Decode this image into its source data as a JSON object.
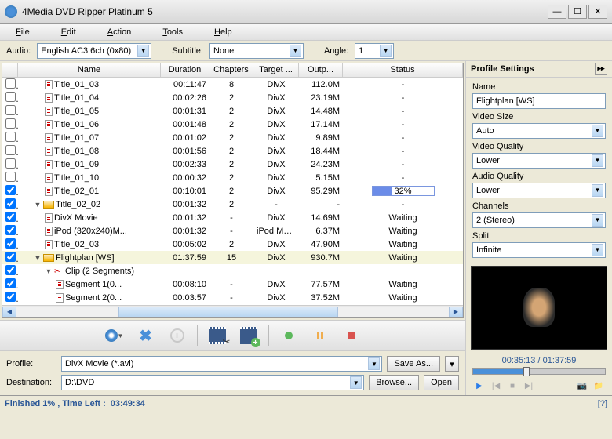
{
  "window": {
    "title": "4Media DVD Ripper Platinum 5"
  },
  "menu": [
    "File",
    "Edit",
    "Action",
    "Tools",
    "Help"
  ],
  "toolbar": {
    "audio_label": "Audio:",
    "audio_value": "English AC3 6ch (0x80)",
    "subtitle_label": "Subtitle:",
    "subtitle_value": "None",
    "angle_label": "Angle:",
    "angle_value": "1"
  },
  "columns": [
    "",
    "Name",
    "Duration",
    "Chapters",
    "Target ...",
    "Outp...",
    "Status"
  ],
  "rows": [
    {
      "chk": false,
      "indent": 2,
      "icon": "file",
      "name": "Title_01_03",
      "dur": "00:11:47",
      "chap": "8",
      "tar": "DivX",
      "out": "112.0M",
      "stat": "-"
    },
    {
      "chk": false,
      "indent": 2,
      "icon": "file",
      "name": "Title_01_04",
      "dur": "00:02:26",
      "chap": "2",
      "tar": "DivX",
      "out": "23.19M",
      "stat": "-"
    },
    {
      "chk": false,
      "indent": 2,
      "icon": "file",
      "name": "Title_01_05",
      "dur": "00:01:31",
      "chap": "2",
      "tar": "DivX",
      "out": "14.48M",
      "stat": "-"
    },
    {
      "chk": false,
      "indent": 2,
      "icon": "file",
      "name": "Title_01_06",
      "dur": "00:01:48",
      "chap": "2",
      "tar": "DivX",
      "out": "17.14M",
      "stat": "-"
    },
    {
      "chk": false,
      "indent": 2,
      "icon": "file",
      "name": "Title_01_07",
      "dur": "00:01:02",
      "chap": "2",
      "tar": "DivX",
      "out": "9.89M",
      "stat": "-"
    },
    {
      "chk": false,
      "indent": 2,
      "icon": "file",
      "name": "Title_01_08",
      "dur": "00:01:56",
      "chap": "2",
      "tar": "DivX",
      "out": "18.44M",
      "stat": "-"
    },
    {
      "chk": false,
      "indent": 2,
      "icon": "file",
      "name": "Title_01_09",
      "dur": "00:02:33",
      "chap": "2",
      "tar": "DivX",
      "out": "24.23M",
      "stat": "-"
    },
    {
      "chk": false,
      "indent": 2,
      "icon": "file",
      "name": "Title_01_10",
      "dur": "00:00:32",
      "chap": "2",
      "tar": "DivX",
      "out": "5.15M",
      "stat": "-"
    },
    {
      "chk": true,
      "indent": 2,
      "icon": "file",
      "name": "Title_02_01",
      "dur": "00:10:01",
      "chap": "2",
      "tar": "DivX",
      "out": "95.29M",
      "stat": "progress",
      "pct": 32
    },
    {
      "chk": true,
      "indent": 1,
      "expand": "▼",
      "icon": "folder",
      "name": "Title_02_02",
      "dur": "00:01:32",
      "chap": "2",
      "tar": "-",
      "out": "-",
      "stat": "-"
    },
    {
      "chk": true,
      "indent": 2,
      "icon": "file",
      "name": "DivX Movie",
      "dur": "00:01:32",
      "chap": "-",
      "tar": "DivX",
      "out": "14.69M",
      "stat": "Waiting"
    },
    {
      "chk": true,
      "indent": 2,
      "icon": "file",
      "name": "iPod (320x240)M...",
      "dur": "00:01:32",
      "chap": "-",
      "tar": "iPod Movie",
      "out": "6.37M",
      "stat": "Waiting"
    },
    {
      "chk": true,
      "indent": 2,
      "icon": "file",
      "name": "Title_02_03",
      "dur": "00:05:02",
      "chap": "2",
      "tar": "DivX",
      "out": "47.90M",
      "stat": "Waiting"
    },
    {
      "chk": true,
      "indent": 1,
      "expand": "▼",
      "icon": "folder",
      "name": "Flightplan [WS]",
      "dur": "01:37:59",
      "chap": "15",
      "tar": "DivX",
      "out": "930.7M",
      "stat": "Waiting",
      "sel": true
    },
    {
      "chk": true,
      "indent": 2,
      "expand": "▼",
      "icon": "clip",
      "name": "Clip (2 Segments)",
      "dur": "",
      "chap": "",
      "tar": "",
      "out": "",
      "stat": ""
    },
    {
      "chk": true,
      "indent": 3,
      "icon": "file",
      "name": "Segment 1(0...",
      "dur": "00:08:10",
      "chap": "-",
      "tar": "DivX",
      "out": "77.57M",
      "stat": "Waiting"
    },
    {
      "chk": true,
      "indent": 3,
      "icon": "file",
      "name": "Segment 2(0...",
      "dur": "00:03:57",
      "chap": "-",
      "tar": "DivX",
      "out": "37.52M",
      "stat": "Waiting"
    }
  ],
  "profile": {
    "profile_label": "Profile:",
    "profile_value": "DivX Movie (*.avi)",
    "saveas": "Save As...",
    "dest_label": "Destination:",
    "dest_value": "D:\\DVD",
    "browse": "Browse...",
    "open": "Open"
  },
  "status": {
    "text": "Finished 1%    , Time Left :  ",
    "time": "03:49:34",
    "help": "[?]"
  },
  "settings": {
    "title": "Profile Settings",
    "name_label": "Name",
    "name_value": "Flightplan [WS]",
    "vsize_label": "Video Size",
    "vsize_value": "Auto",
    "vqual_label": "Video Quality",
    "vqual_value": "Lower",
    "aqual_label": "Audio Quality",
    "aqual_value": "Lower",
    "chan_label": "Channels",
    "chan_value": "2 (Stereo)",
    "split_label": "Split",
    "split_value": "Infinite"
  },
  "preview": {
    "time": "00:35:13 / 01:37:59"
  }
}
